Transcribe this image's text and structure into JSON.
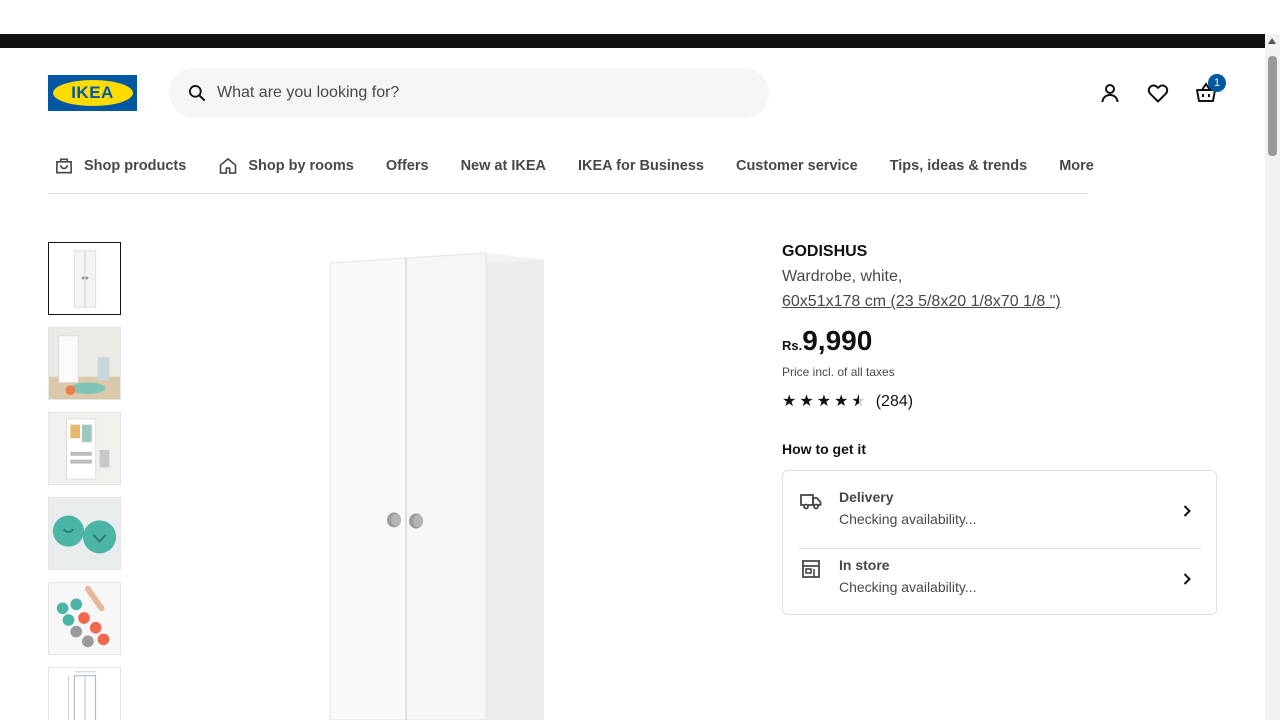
{
  "header": {
    "logo_text": "IKEA",
    "search_placeholder": "What are you looking for?",
    "cart_count": "1",
    "icons": [
      "search-icon",
      "user-icon",
      "heart-icon",
      "cart-icon"
    ]
  },
  "nav": {
    "items": [
      {
        "label": "Shop products",
        "icon": "shopping-bag-icon"
      },
      {
        "label": "Shop by rooms",
        "icon": "house-icon"
      },
      {
        "label": "Offers"
      },
      {
        "label": "New at IKEA"
      },
      {
        "label": "IKEA for Business"
      },
      {
        "label": "Customer service"
      },
      {
        "label": "Tips, ideas & trends"
      },
      {
        "label": "More"
      }
    ]
  },
  "product": {
    "name": "GODISHUS",
    "description": "Wardrobe, white,",
    "dimensions": "60x51x178 cm (23 5/8x20 1/8x70 1/8 \")",
    "currency": "Rs.",
    "price": "9,990",
    "tax_note": "Price incl. of all taxes",
    "rating_stars": 4.5,
    "rating_count": "(284)"
  },
  "availability": {
    "heading": "How to get it",
    "delivery": {
      "title": "Delivery",
      "status": "Checking availability..."
    },
    "in_store": {
      "title": "In store",
      "status": "Checking availability..."
    }
  },
  "colors": {
    "brand_blue": "#0058a3",
    "brand_yellow": "#ffdb00",
    "text_dark": "#111111",
    "text_muted": "#484848"
  }
}
